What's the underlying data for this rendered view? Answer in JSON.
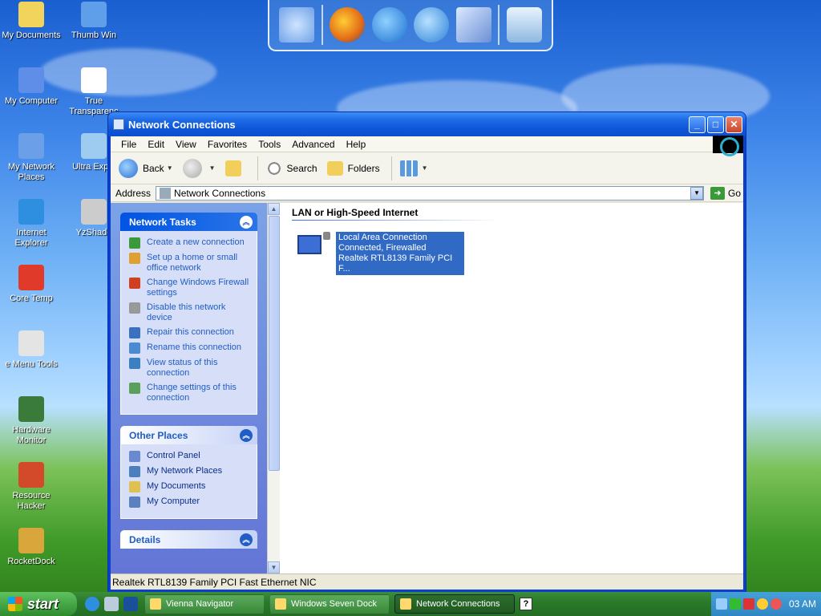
{
  "desktop": {
    "icons": [
      {
        "label": "My Documents",
        "color": "#f2d35c"
      },
      {
        "label": "Thumb Win",
        "color": "#5f9ee8"
      },
      {
        "label": "My Computer",
        "color": "#5f8ee8"
      },
      {
        "label": "True Transparenc",
        "color": "#ffffff"
      },
      {
        "label": "My Network Places",
        "color": "#6ba0e8"
      },
      {
        "label": "Ultra Explo",
        "color": "#9ecbf0"
      },
      {
        "label": "Internet Explorer",
        "color": "#2e8fe0"
      },
      {
        "label": "YzShado",
        "color": "#cccccc"
      },
      {
        "label": "Core Temp",
        "color": "#e03a2a"
      },
      {
        "label": "e Menu Tools",
        "color": "#e4e4e4"
      },
      {
        "label": "Hardware Monitor",
        "color": "#3a7a3a"
      },
      {
        "label": "Resource Hacker",
        "color": "#d24a2a"
      },
      {
        "label": "RocketDock",
        "color": "#d8a63a"
      }
    ]
  },
  "dock": {
    "icons": [
      "monitor-icon",
      "firefox-icon",
      "ie-icon",
      "media-player-icon",
      "control-panel-icon",
      "recycle-bin-icon"
    ]
  },
  "window": {
    "title": "Network Connections",
    "menu": [
      "File",
      "Edit",
      "View",
      "Favorites",
      "Tools",
      "Advanced",
      "Help"
    ],
    "toolbar": {
      "back": "Back",
      "search": "Search",
      "folders": "Folders"
    },
    "address": {
      "label": "Address",
      "value": "Network Connections",
      "go": "Go"
    },
    "tasks_panel": {
      "title": "Network Tasks",
      "items": [
        {
          "label": "Create a new connection"
        },
        {
          "label": "Set up a home or small office network"
        },
        {
          "label": "Change Windows Firewall settings"
        },
        {
          "label": "Disable this network device"
        },
        {
          "label": "Repair this connection"
        },
        {
          "label": "Rename this connection"
        },
        {
          "label": "View status of this connection"
        },
        {
          "label": "Change settings of this connection"
        }
      ]
    },
    "other_places": {
      "title": "Other Places",
      "items": [
        {
          "label": "Control Panel"
        },
        {
          "label": "My Network Places"
        },
        {
          "label": "My Documents"
        },
        {
          "label": "My Computer"
        }
      ]
    },
    "details": {
      "title": "Details"
    },
    "group": {
      "title": "LAN or High-Speed Internet",
      "connection": {
        "name": "Local Area Connection",
        "status": "Connected, Firewalled",
        "device": "Realtek RTL8139 Family PCI F..."
      }
    },
    "status_bar": "Realtek RTL8139 Family PCI Fast Ethernet NIC"
  },
  "taskbar": {
    "start": "start",
    "buttons": [
      {
        "label": "Vienna Navigator",
        "active": false
      },
      {
        "label": "Windows Seven Dock",
        "active": false
      },
      {
        "label": "Network Connections",
        "active": true
      }
    ],
    "clock": "03 AM"
  }
}
